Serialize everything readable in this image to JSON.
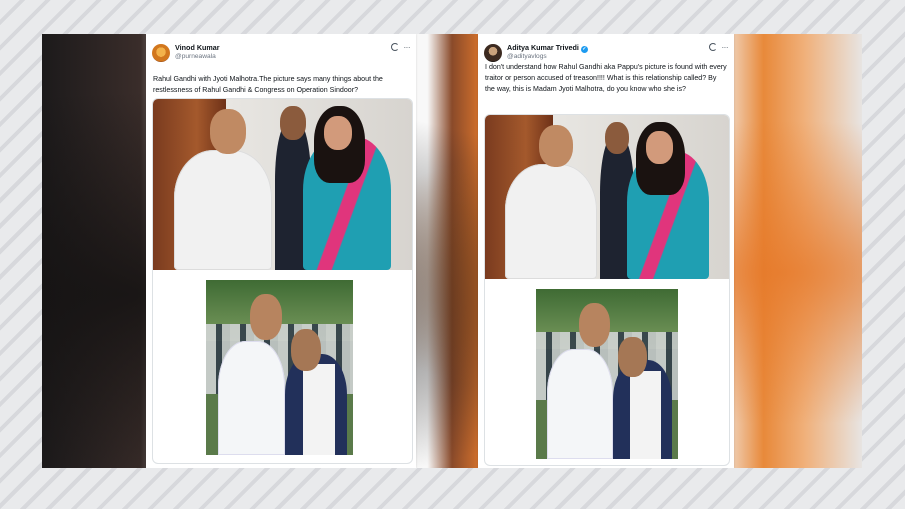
{
  "posts": [
    {
      "author": "Vinod Kumar",
      "handle": "@purneawala",
      "verified": false,
      "text": "Rahul Gandhi with Jyoti Malhotra.The picture says many things about the restlessness of Rahul Gandhi & Congress on Operation Sindoor?"
    },
    {
      "author": "Aditya Kumar Trivedi",
      "handle": "@adityavlogs",
      "verified": true,
      "text": "I don't understand how Rahul Gandhi aka Pappu's picture is found with every traitor or person accused of treason!!!! What is this relationship called? By the way, this is Madam Jyoti Malhotra, do you know who she is?"
    }
  ],
  "icons": {
    "grok": "grok-icon",
    "more": "more-icon",
    "more_glyph": "···",
    "verified": "verified-badge-icon",
    "verified_glyph": "✓"
  },
  "colors": {
    "accent_blue": "#1d9bf0",
    "text_primary": "#0f1419",
    "text_secondary": "#6b7480"
  }
}
